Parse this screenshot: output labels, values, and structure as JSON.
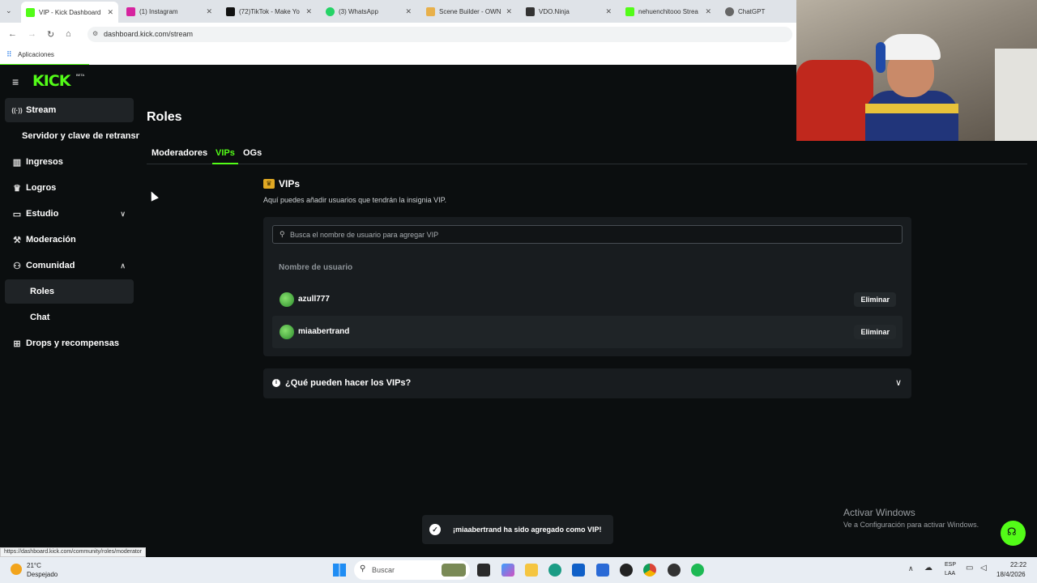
{
  "browser": {
    "tabs": [
      {
        "label": "VIP - Kick Dashboard",
        "color": "#53fc18",
        "active": true
      },
      {
        "label": "(1) Instagram",
        "color": "#d6249f"
      },
      {
        "label": "(72)TikTok - Make Yo",
        "color": "#111111"
      },
      {
        "label": "(3) WhatsApp",
        "color": "#25d366"
      },
      {
        "label": "Scene Builder - OWN",
        "color": "#e8b04a"
      },
      {
        "label": "VDO.Ninja",
        "color": "#333333"
      },
      {
        "label": "nehuenchitooo Strea",
        "color": "#53fc18"
      },
      {
        "label": "ChatGPT",
        "color": "#666666"
      }
    ],
    "url": "dashboard.kick.com/stream",
    "bookmark": "Aplicaciones",
    "status_url": "https://dashboard.kick.com/community/roles/moderator"
  },
  "sidebar": {
    "logo": "KICK",
    "logo_badge": "BETA",
    "items": [
      {
        "label": "Stream",
        "icon": "broadcast-icon",
        "glyph": "((·))"
      },
      {
        "label": "Servidor y clave de retransn",
        "icon": "",
        "glyph": ""
      },
      {
        "label": "Ingresos",
        "icon": "chart-icon",
        "glyph": "▥"
      },
      {
        "label": "Logros",
        "icon": "trophy-icon",
        "glyph": "🏆"
      },
      {
        "label": "Estudio",
        "icon": "studio-icon",
        "glyph": "▭"
      },
      {
        "label": "Moderación",
        "icon": "hammer-icon",
        "glyph": "⚒"
      },
      {
        "label": "Comunidad",
        "icon": "users-icon",
        "glyph": "👥"
      },
      {
        "label": "Roles",
        "icon": "",
        "glyph": ""
      },
      {
        "label": "Chat",
        "icon": "",
        "glyph": ""
      },
      {
        "label": "Drops y recompensas",
        "icon": "gift-icon",
        "glyph": "🎁"
      }
    ]
  },
  "main": {
    "title": "Roles",
    "tabs": [
      "Moderadores",
      "VIPs",
      "OGs"
    ],
    "section_title": "VIPs",
    "section_desc": "Aquí puedes añadir usuarios que tendrán la insignia VIP.",
    "search_placeholder": "Busca el nombre de usuario para agregar VIP",
    "column_header": "Nombre de usuario",
    "users": [
      {
        "name": "azull777",
        "action": "Eliminar"
      },
      {
        "name": "miaabertrand",
        "action": "Eliminar"
      }
    ],
    "faq": "¿Qué pueden hacer los VIPs?"
  },
  "toast": "¡miaabertrand ha sido agregado como VIP!",
  "watermark": {
    "title": "Activar Windows",
    "subtitle": "Ve a Configuración para activar Windows."
  },
  "taskbar": {
    "weather_temp": "21°C",
    "weather_desc": "Despejado",
    "search": "Buscar",
    "lang1": "ESP",
    "lang2": "LAA",
    "time": "22:22",
    "date": "18/4/2026"
  },
  "colors": {
    "accent": "#53fc18",
    "bg": "#0b0e0f",
    "card": "#181c1f"
  }
}
